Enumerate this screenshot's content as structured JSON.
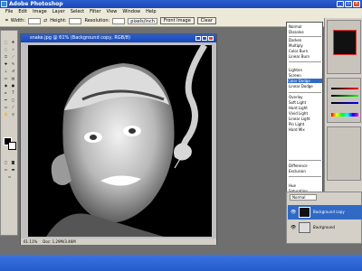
{
  "app": {
    "title": "Adobe Photoshop"
  },
  "menubar": {
    "items": [
      "File",
      "Edit",
      "Image",
      "Layer",
      "Select",
      "Filter",
      "View",
      "Window",
      "Help"
    ]
  },
  "options": {
    "width_label": "Width:",
    "height_label": "Height:",
    "resolution_label": "Resolution:",
    "resolution_unit": "pixels/inch",
    "front_image": "Front Image",
    "clear": "Clear"
  },
  "document": {
    "title": "snake.jpg @ 61% (Background copy, RGB/8)",
    "zoom": "61.11%",
    "doc_size": "Doc: 1.29M/3.46M"
  },
  "blend_menu": {
    "items": [
      "Normal",
      "Dissolve",
      "Darken",
      "Multiply",
      "Color Burn",
      "Linear Burn",
      "Lighten",
      "Screen",
      "Color Dodge",
      "Linear Dodge",
      "Overlay",
      "Soft Light",
      "Hard Light",
      "Vivid Light",
      "Linear Light",
      "Pin Light",
      "Hard Mix",
      "Difference",
      "Exclusion",
      "Hue",
      "Saturation",
      "Color",
      "Luminosity"
    ],
    "selected": "Color Dodge"
  },
  "layers": {
    "mode": "Normal",
    "items": [
      "Background copy",
      "Background"
    ]
  }
}
